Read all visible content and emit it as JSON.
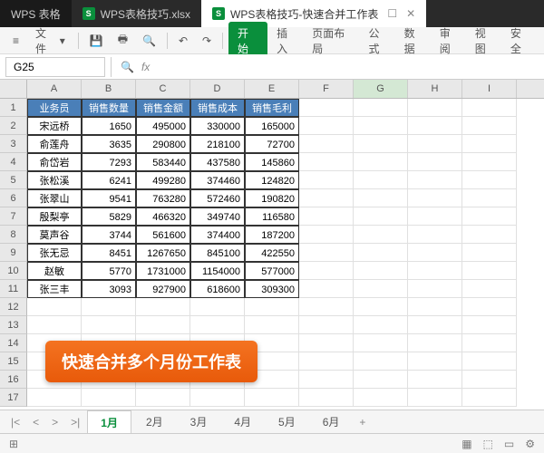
{
  "tabs": [
    {
      "label": "WPS 表格",
      "icon": ""
    },
    {
      "label": "WPS表格技巧.xlsx",
      "icon": "S"
    },
    {
      "label": "WPS表格技巧-快速合并工作表",
      "icon": "S"
    }
  ],
  "toolbar": {
    "file": "文件",
    "menu": {
      "start": "开始",
      "insert": "插入",
      "layout": "页面布局",
      "formula": "公式",
      "data": "数据",
      "review": "审阅",
      "view": "视图",
      "safe": "安全"
    }
  },
  "formula": {
    "cell_ref": "G25",
    "fx": "fx"
  },
  "columns": [
    "A",
    "B",
    "C",
    "D",
    "E",
    "F",
    "G",
    "H",
    "I"
  ],
  "headers": [
    "业务员",
    "销售数量",
    "销售金额",
    "销售成本",
    "销售毛利"
  ],
  "data_rows": [
    [
      "宋远桥",
      "1650",
      "495000",
      "330000",
      "165000"
    ],
    [
      "俞莲舟",
      "3635",
      "290800",
      "218100",
      "72700"
    ],
    [
      "俞岱岩",
      "7293",
      "583440",
      "437580",
      "145860"
    ],
    [
      "张松溪",
      "6241",
      "499280",
      "374460",
      "124820"
    ],
    [
      "张翠山",
      "9541",
      "763280",
      "572460",
      "190820"
    ],
    [
      "殷梨亭",
      "5829",
      "466320",
      "349740",
      "116580"
    ],
    [
      "莫声谷",
      "3744",
      "561600",
      "374400",
      "187200"
    ],
    [
      "张无忌",
      "8451",
      "1267650",
      "845100",
      "422550"
    ],
    [
      "赵敏",
      "5770",
      "1731000",
      "1154000",
      "577000"
    ],
    [
      "张三丰",
      "3093",
      "927900",
      "618600",
      "309300"
    ]
  ],
  "callout": "快速合并多个月份工作表",
  "sheets": [
    "1月",
    "2月",
    "3月",
    "4月",
    "5月",
    "6月"
  ],
  "selected_col": "G"
}
